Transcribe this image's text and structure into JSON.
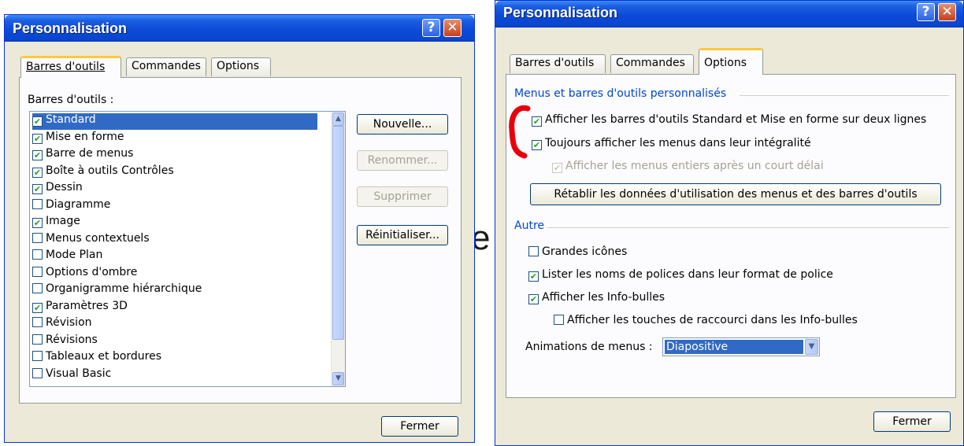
{
  "background_fragments": [
    "e"
  ],
  "left_dialog": {
    "title": "Personnalisation",
    "help_glyph": "?",
    "close_glyph": "✕",
    "tabs": [
      {
        "label": "Barres d'outils",
        "active": true
      },
      {
        "label": "Commandes",
        "active": false
      },
      {
        "label": "Options",
        "active": false
      }
    ],
    "list_label": "Barres d'outils :",
    "toolbars": [
      {
        "label": "Standard",
        "checked": true,
        "selected": true
      },
      {
        "label": "Mise en forme",
        "checked": true
      },
      {
        "label": "Barre de menus",
        "checked": true
      },
      {
        "label": "Boîte à outils Contrôles",
        "checked": true
      },
      {
        "label": "Dessin",
        "checked": true
      },
      {
        "label": "Diagramme",
        "checked": false
      },
      {
        "label": "Image",
        "checked": true
      },
      {
        "label": "Menus contextuels",
        "checked": false
      },
      {
        "label": "Mode Plan",
        "checked": false
      },
      {
        "label": "Options d'ombre",
        "checked": false
      },
      {
        "label": "Organigramme hiérarchique",
        "checked": false
      },
      {
        "label": "Paramètres 3D",
        "checked": true
      },
      {
        "label": "Révision",
        "checked": false
      },
      {
        "label": "Révisions",
        "checked": false
      },
      {
        "label": "Tableaux et bordures",
        "checked": false
      },
      {
        "label": "Visual Basic",
        "checked": false
      }
    ],
    "buttons": {
      "new": "Nouvelle...",
      "rename": "Renommer...",
      "delete": "Supprimer",
      "reset": "Réinitialiser...",
      "close": "Fermer"
    }
  },
  "right_dialog": {
    "title": "Personnalisation",
    "help_glyph": "?",
    "close_glyph": "✕",
    "tabs": [
      {
        "label": "Barres d'outils",
        "active": false
      },
      {
        "label": "Commandes",
        "active": false
      },
      {
        "label": "Options",
        "active": true
      }
    ],
    "group1_title": "Menus et barres d'outils personnalisés",
    "opt_two_lines": "Afficher les barres d'outils Standard et Mise en forme sur deux lignes",
    "opt_full_menus": "Toujours afficher les menus dans leur intégralité",
    "opt_delay": "Afficher les menus entiers après un court délai",
    "reset_usage_button": "Rétablir les données d'utilisation des menus et des barres d'outils",
    "group2_title": "Autre",
    "opt_large_icons": "Grandes icônes",
    "opt_font_names": "Lister les noms de polices dans leur format de police",
    "opt_tooltips": "Afficher les Info-bulles",
    "opt_shortcuts": "Afficher les touches de raccourci dans les Info-bulles",
    "animations_label": "Animations de menus :",
    "animations_value": "Diapositive",
    "close_button": "Fermer"
  },
  "colors": {
    "dialog_bg": "#ece9d8",
    "titlebar_blue": "#0b4ad8",
    "check_green": "#21a121",
    "selection_blue": "#316ac5",
    "group_title_blue": "#0046d5",
    "red_annotation": "#e8000b"
  }
}
